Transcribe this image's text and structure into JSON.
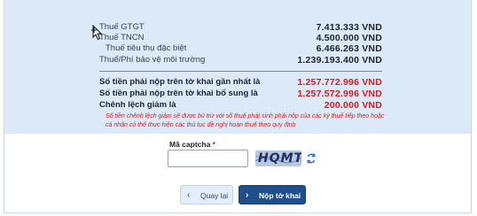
{
  "summary": {
    "rows": [
      {
        "label": "Thuế GTGT",
        "value": "7.413.333 VND"
      },
      {
        "label": "Thuế TNCN",
        "value": "4.500.000 VND"
      },
      {
        "label": "Thuế tiêu thụ đặc biệt",
        "value": "6.466.263 VND"
      },
      {
        "label": "Thuế/Phí bảo vệ môi trường",
        "value": "1.239.193.400 VND"
      }
    ],
    "totals": [
      {
        "label": "Số tiền phải nộp trên tờ khai gần nhất là",
        "value": "1.257.772.996 VND"
      },
      {
        "label": "Số tiền phải nộp trên tờ khai bổ sung là",
        "value": "1.257.572.996 VND"
      },
      {
        "label": "Chênh lệch giảm là",
        "value": "200.000 VND"
      }
    ],
    "note": "Số tiền chênh lệch giảm sẽ được bù trừ với số thuế phát sinh phải nộp của các kỳ thuế tiếp theo hoặc cá nhân có thể thực hiện các thủ tục đề nghị hoàn thuế theo quy định"
  },
  "captcha": {
    "label": "Mã captcha",
    "required_mark": "*",
    "value": "",
    "image_text": "HQMT"
  },
  "buttons": {
    "back_label": "Quay lại",
    "submit_label": "Nộp tờ khai"
  },
  "colors": {
    "panel_bg": "#dce9f8",
    "accent_red": "#d11f24",
    "primary_button": "#1f4e8c"
  },
  "icons": {
    "back": "chevron-left-icon",
    "submit": "chevron-right-icon",
    "refresh": "refresh-icon",
    "cursor": "move-cursor-icon"
  }
}
